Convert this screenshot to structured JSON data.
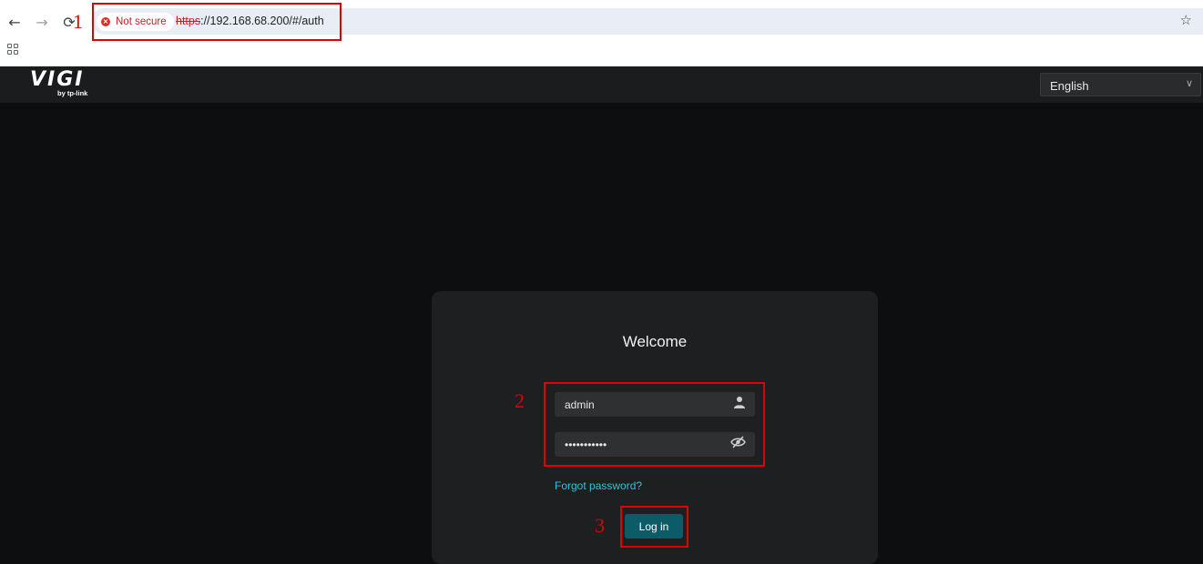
{
  "browser": {
    "back_icon": "←",
    "forward_icon": "→",
    "reload_icon": "⟳",
    "security_chip_label": "Not secure",
    "url_scheme": "https",
    "url_rest": "://192.168.68.200/#/auth",
    "bookmark_icon": "☆"
  },
  "header": {
    "logo_main": "VIGI",
    "logo_sub": "by tp-link",
    "language_value": "English",
    "language_caret": "∨"
  },
  "login": {
    "title": "Welcome",
    "username_value": "admin",
    "password_value": "•••••••••••",
    "user_icon": "👤",
    "eye_icon": "⊘",
    "forgot_label": "Forgot password?",
    "login_label": "Log in"
  },
  "annotations": {
    "n1": "1",
    "n2": "2",
    "n3": "3"
  },
  "colors": {
    "accent_button": "#0c5c68",
    "link": "#2ec3d6",
    "annotation": "#e00000"
  }
}
